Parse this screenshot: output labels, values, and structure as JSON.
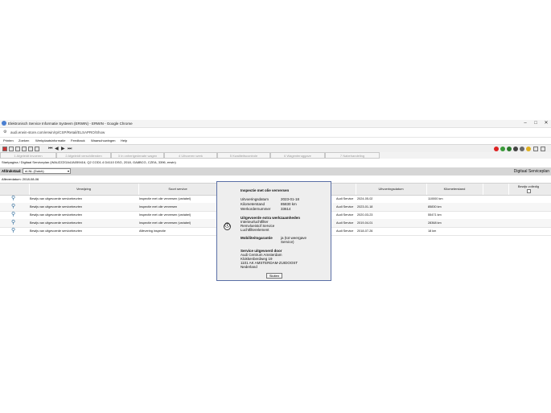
{
  "window": {
    "title": "Elektronisch Service Informatie Systeem (ERWIN) - ERWIN - Google Chrome",
    "url": "audi.erwin-store.com/erwin/rp/CSP/Retail/ELSAPRO/Show"
  },
  "menu": [
    "Printen",
    "Zoeken",
    "Werkplaatsinformatie",
    "Feedback",
    "Waarschuwingen",
    "Help"
  ],
  "steps": [
    "1 Afgeleidt invoeren",
    "2 Afgeleidt verschillenden",
    "3 In onherigedenate wagen",
    "4 Uitvoeren werk",
    "5 Kwaliteitscontrole",
    "6 Wagenteruggave",
    "7 Nabehandeling"
  ],
  "breadcrumb": "Startpagina / Digitaal Serviceplan (WAUZZZGA4JA059416, Q2 COD1.4 D4110 DSG, 2018, GA8BCG, CZEA, 3396, erwin)",
  "lang": {
    "label": "Afdrukstaal:",
    "selected": "nl-NL (Dutch)",
    "page_title": "Digitaal Serviceplan"
  },
  "delivery_date": "Afleverdatum: 2018-08-06",
  "table": {
    "headers": {
      "verwijzing": "Verwijzing",
      "soort": "Soort service",
      "datum": "Uitvoeringsdatum",
      "km": "Kilometerstand",
      "volledig": "Bewijs volledig"
    },
    "rows": [
      {
        "ref": "Bewijs van uitgevoerde servicebeurten",
        "soort": "Inspectie met olie verversen (variabel)",
        "dealer": "Audi Service",
        "date": "2024-05-02",
        "km": "110000 km"
      },
      {
        "ref": "Bewijs van uitgevoerde servicebeurten",
        "soort": "Inspectie met olie verversen",
        "dealer": "Audi Service",
        "date": "2023-01-18",
        "km": "85830 km"
      },
      {
        "ref": "Bewijs van uitgevoerde servicebeurten",
        "soort": "Inspectie met olie verversen (variabel)",
        "dealer": "Audi Service",
        "date": "2020-03-23",
        "km": "55471 km"
      },
      {
        "ref": "Bewijs van uitgevoerde servicebeurten",
        "soort": "Inspectie met olie verversen (variabel)",
        "dealer": "Audi Service",
        "date": "2019-04-01",
        "km": "28368 km"
      },
      {
        "ref": "Bewijs van uitgevoerde servicebeurten",
        "soort": "Aflevering inspectie",
        "dealer": "Audi Service",
        "date": "2018-07-26",
        "km": "18 km"
      }
    ]
  },
  "dialog": {
    "title": "Inspectie met olie verversen",
    "fields": [
      {
        "label": "Uitvoeringsdatum",
        "value": "2023-01-18"
      },
      {
        "label": "Kilometerstand",
        "value": "85830 km"
      },
      {
        "label": "Werkordernummer",
        "value": "33614"
      }
    ],
    "extra_heading": "Uitgevoerde extra werkzaamheden",
    "extra_items": [
      "Interieurluchtfilter",
      "Remvloeistof Service",
      "Luchtfilterelement"
    ],
    "mobility_label": "Mobiliteitsgarantie",
    "mobility_value_1": "ja (tot weergave",
    "mobility_value_2": "Service)",
    "service_heading": "Service uitgevoerd door",
    "service_lines": [
      "Audi Centrum Amsterdam",
      "Klokkenberdweg 19",
      "1101 AK AMSTERDAM-ZUIDOOST",
      "Nederland"
    ],
    "close_label": "Sluiten"
  },
  "icons": {
    "info": "ⓘ",
    "magnifier": "⚲"
  }
}
